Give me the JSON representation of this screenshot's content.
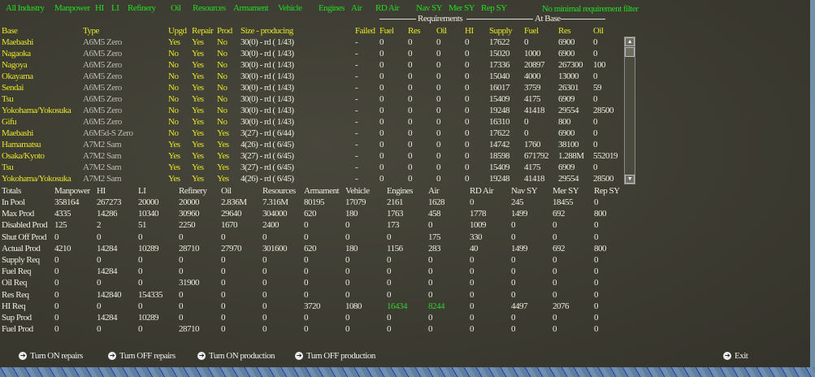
{
  "filters": [
    "All Industry",
    "Manpower",
    "HI",
    "LI",
    "Refinery",
    "Oil",
    "Resources",
    "Armament",
    "Vehicle",
    "Engines",
    "Air",
    "RD Air",
    "Nav SY",
    "Mer SY",
    "Rep SY"
  ],
  "filter_mode": "No minimal requirement filter",
  "group_headers": {
    "requirements": "Requirements",
    "at_base": "At Base"
  },
  "table": {
    "headers": [
      "Base",
      "Type",
      "Upgd",
      "Repair",
      "Prod",
      "Size - producing",
      "Failed",
      "Fuel",
      "Res",
      "Oil",
      "HI",
      "Supply",
      "Fuel",
      "Res",
      "Oil"
    ],
    "rows": [
      [
        "Maebashi",
        "A6M5 Zero",
        "Yes",
        "Yes",
        "No",
        "30(0) - rd ( 1/43)",
        "-",
        "0",
        "0",
        "0",
        "0",
        "17622",
        "0",
        "6900",
        "0"
      ],
      [
        "Nagaoka",
        "A6M5 Zero",
        "No",
        "Yes",
        "No",
        "30(0) - rd ( 1/43)",
        "-",
        "0",
        "0",
        "0",
        "0",
        "15020",
        "1000",
        "6900",
        "0"
      ],
      [
        "Nagoya",
        "A6M5 Zero",
        "No",
        "Yes",
        "No",
        "30(0) - rd ( 1/43)",
        "-",
        "0",
        "0",
        "0",
        "0",
        "17336",
        "20897",
        "267300",
        "100"
      ],
      [
        "Okayama",
        "A6M5 Zero",
        "No",
        "Yes",
        "No",
        "30(0) - rd ( 1/43)",
        "-",
        "0",
        "0",
        "0",
        "0",
        "15040",
        "4000",
        "13000",
        "0"
      ],
      [
        "Sendai",
        "A6M5 Zero",
        "No",
        "Yes",
        "No",
        "30(0) - rd ( 1/43)",
        "-",
        "0",
        "0",
        "0",
        "0",
        "16017",
        "3759",
        "26301",
        "59"
      ],
      [
        "Tsu",
        "A6M5 Zero",
        "No",
        "Yes",
        "No",
        "30(0) - rd ( 1/43)",
        "-",
        "0",
        "0",
        "0",
        "0",
        "15409",
        "4175",
        "6909",
        "0"
      ],
      [
        "Yokohama/Yokosuka",
        "A6M5 Zero",
        "No",
        "Yes",
        "No",
        "30(0) - rd ( 1/43)",
        "-",
        "0",
        "0",
        "0",
        "0",
        "19248",
        "41418",
        "29554",
        "28500"
      ],
      [
        "Gifu",
        "A6M5 Zero",
        "No",
        "Yes",
        "No",
        "30(0) - rd ( 1/43)",
        "-",
        "0",
        "0",
        "0",
        "0",
        "16310",
        "0",
        "800",
        "0"
      ],
      [
        "Maebashi",
        "A6M5d-S Zero",
        "No",
        "Yes",
        "Yes",
        "3(27) - rd ( 6/44)",
        "-",
        "0",
        "0",
        "0",
        "0",
        "17622",
        "0",
        "6900",
        "0"
      ],
      [
        "Hamamatsu",
        "A7M2 Sam",
        "Yes",
        "Yes",
        "Yes",
        "4(26) - rd ( 6/45)",
        "-",
        "0",
        "0",
        "0",
        "0",
        "14742",
        "1760",
        "38100",
        "0"
      ],
      [
        "Osaka/Kyoto",
        "A7M2 Sam",
        "Yes",
        "Yes",
        "Yes",
        "3(27) - rd ( 6/45)",
        "-",
        "0",
        "0",
        "0",
        "0",
        "18598",
        "671792",
        "1.288M",
        "552019"
      ],
      [
        "Tsu",
        "A7M2 Sam",
        "Yes",
        "Yes",
        "Yes",
        "3(27) - rd ( 6/45)",
        "-",
        "0",
        "0",
        "0",
        "0",
        "15409",
        "4175",
        "6909",
        "0"
      ],
      [
        "Yokohama/Yokosuka",
        "A7M2 Sam",
        "Yes",
        "Yes",
        "Yes",
        "4(26) - rd ( 6/45)",
        "-",
        "0",
        "0",
        "0",
        "0",
        "19248",
        "41418",
        "29554",
        "28500"
      ]
    ]
  },
  "totals": {
    "headers": [
      "Totals",
      "Manpower",
      "HI",
      "LI",
      "Refinery",
      "Oil",
      "Resources",
      "Armament",
      "Vehicle",
      "Engines",
      "Air",
      "RD Air",
      "Nav SY",
      "Mer SY",
      "Rep SY"
    ],
    "rows": [
      [
        "In Pool",
        "358164",
        "267273",
        "20000",
        "20000",
        "2.836M",
        "7.316M",
        "80195",
        "17079",
        "2161",
        "1628",
        "0",
        "245",
        "18455",
        "0"
      ],
      [
        "Max Prod",
        "4335",
        "14286",
        "10340",
        "30960",
        "29640",
        "304000",
        "620",
        "180",
        "1763",
        "458",
        "1778",
        "1499",
        "692",
        "800"
      ],
      [
        "Disabled Prod",
        "125",
        "2",
        "51",
        "2250",
        "1670",
        "2400",
        "0",
        "0",
        "173",
        "0",
        "1009",
        "0",
        "0",
        "0"
      ],
      [
        "Shut Off Prod",
        "0",
        "0",
        "0",
        "0",
        "0",
        "0",
        "0",
        "0",
        "0",
        "175",
        "330",
        "0",
        "0",
        "0"
      ],
      [
        "Actual Prod",
        "4210",
        "14284",
        "10289",
        "28710",
        "27970",
        "301600",
        "620",
        "180",
        "1156",
        "283",
        "40",
        "1499",
        "692",
        "800"
      ],
      [
        "Supply Req",
        "0",
        "0",
        "0",
        "0",
        "0",
        "0",
        "0",
        "0",
        "0",
        "0",
        "0",
        "0",
        "0",
        "0"
      ],
      [
        "Fuel Req",
        "0",
        "14284",
        "0",
        "0",
        "0",
        "0",
        "0",
        "0",
        "0",
        "0",
        "0",
        "0",
        "0",
        "0"
      ],
      [
        "Oil Req",
        "0",
        "0",
        "0",
        "31900",
        "0",
        "0",
        "0",
        "0",
        "0",
        "0",
        "0",
        "0",
        "0",
        "0"
      ],
      [
        "Res Req",
        "0",
        "142840",
        "154335",
        "0",
        "0",
        "0",
        "0",
        "0",
        "0",
        "0",
        "0",
        "0",
        "0",
        "0"
      ],
      [
        "HI Req",
        "0",
        "0",
        "0",
        "0",
        "0",
        "0",
        "3720",
        "1080",
        "16434",
        "8244",
        "0",
        "4497",
        "2076",
        "0"
      ],
      [
        "Sup Prod",
        "0",
        "14284",
        "10289",
        "0",
        "0",
        "0",
        "0",
        "0",
        "0",
        "0",
        "0",
        "0",
        "0",
        "0"
      ],
      [
        "Fuel Prod",
        "0",
        "0",
        "0",
        "28710",
        "0",
        "0",
        "0",
        "0",
        "0",
        "0",
        "0",
        "0",
        "0",
        "0"
      ]
    ]
  },
  "buttons": {
    "repairs_on": "Turn ON repairs",
    "repairs_off": "Turn OFF repairs",
    "prod_on": "Turn ON production",
    "prod_off": "Turn OFF production",
    "exit": "Exit"
  }
}
